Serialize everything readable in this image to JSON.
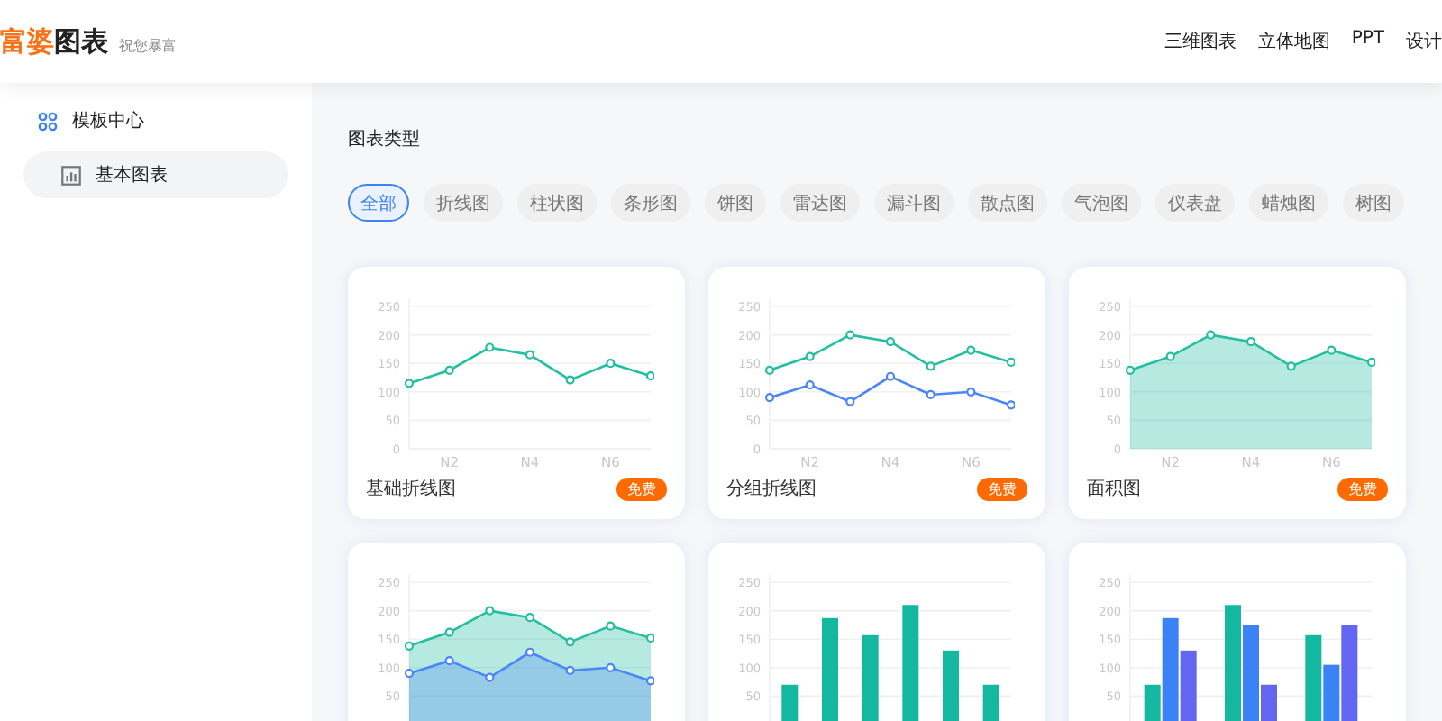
{
  "header": {
    "logo": {
      "accent": "富婆",
      "rest": "图表"
    },
    "tagline": "祝您暴富",
    "nav": [
      "三维图表",
      "立体地图",
      "PPT",
      "设计"
    ]
  },
  "sidebar": {
    "items": [
      {
        "label": "模板中心",
        "kind": "section",
        "selected": false
      },
      {
        "label": "基本图表",
        "kind": "page",
        "selected": true
      }
    ]
  },
  "main": {
    "title": "图表类型",
    "filters": [
      {
        "label": "全部",
        "selected": true
      },
      {
        "label": "折线图",
        "selected": false
      },
      {
        "label": "柱状图",
        "selected": false
      },
      {
        "label": "条形图",
        "selected": false
      },
      {
        "label": "饼图",
        "selected": false
      },
      {
        "label": "雷达图",
        "selected": false
      },
      {
        "label": "漏斗图",
        "selected": false
      },
      {
        "label": "散点图",
        "selected": false
      },
      {
        "label": "气泡图",
        "selected": false
      },
      {
        "label": "仪表盘",
        "selected": false
      },
      {
        "label": "蜡烛图",
        "selected": false
      },
      {
        "label": "树图",
        "selected": false
      }
    ],
    "cards": [
      {
        "title": "基础折线图",
        "badge": "免费",
        "chart_data": {
          "type": "line",
          "categories": [
            null,
            "N2",
            null,
            "N4",
            null,
            "N6",
            null
          ],
          "ylim": [
            0,
            250
          ],
          "yticks": [
            0,
            50,
            100,
            150,
            200,
            250
          ],
          "grid": true,
          "series": [
            {
              "color": "#22bfa0",
              "marker": true,
              "values": [
                115,
                138,
                178,
                165,
                121,
                150,
                128
              ]
            }
          ]
        }
      },
      {
        "title": "分组折线图",
        "badge": "免费",
        "chart_data": {
          "type": "line",
          "categories": [
            null,
            "N2",
            null,
            "N4",
            null,
            "N6",
            null
          ],
          "ylim": [
            0,
            250
          ],
          "yticks": [
            0,
            50,
            100,
            150,
            200,
            250
          ],
          "grid": true,
          "series": [
            {
              "color": "#22bfa0",
              "marker": true,
              "values": [
                138,
                162,
                200,
                188,
                145,
                173,
                152
              ]
            },
            {
              "color": "#4a86f7",
              "marker": true,
              "values": [
                90,
                112,
                83,
                127,
                95,
                100,
                77
              ]
            }
          ]
        }
      },
      {
        "title": "面积图",
        "badge": "免费",
        "chart_data": {
          "type": "area",
          "categories": [
            null,
            "N2",
            null,
            "N4",
            null,
            "N6",
            null
          ],
          "ylim": [
            0,
            250
          ],
          "yticks": [
            0,
            50,
            100,
            150,
            200,
            250
          ],
          "grid": true,
          "series": [
            {
              "color": "#22bfa0",
              "marker": true,
              "values": [
                138,
                162,
                200,
                188,
                145,
                173,
                152
              ]
            }
          ]
        }
      },
      {
        "chart_data": {
          "type": "area",
          "ylim": [
            0,
            250
          ],
          "yticks": [
            50,
            100,
            150,
            200,
            250
          ],
          "grid": true,
          "series": [
            {
              "color": "#22bfa0",
              "marker": true,
              "values": [
                138,
                162,
                200,
                188,
                145,
                173,
                152
              ]
            },
            {
              "color": "#4a86f7",
              "marker": true,
              "values": [
                90,
                112,
                83,
                127,
                95,
                100,
                77
              ]
            }
          ]
        }
      },
      {
        "chart_data": {
          "type": "bar",
          "ylim": [
            0,
            250
          ],
          "yticks": [
            50,
            100,
            150,
            200,
            250
          ],
          "grid": true,
          "series": [
            {
              "color": "#14b8a0",
              "values": [
                70,
                187,
                157,
                210,
                130,
                70
              ]
            }
          ]
        }
      },
      {
        "chart_data": {
          "type": "bar",
          "ylim": [
            0,
            250
          ],
          "yticks": [
            50,
            100,
            150,
            200,
            250
          ],
          "grid": true,
          "series": [
            {
              "color": "#14b8a0",
              "values": [
                70,
                210,
                157
              ]
            },
            {
              "color": "#3b82f6",
              "values": [
                187,
                175,
                105
              ]
            },
            {
              "color": "#6366f1",
              "values": [
                130,
                70,
                175
              ]
            }
          ]
        }
      }
    ]
  }
}
